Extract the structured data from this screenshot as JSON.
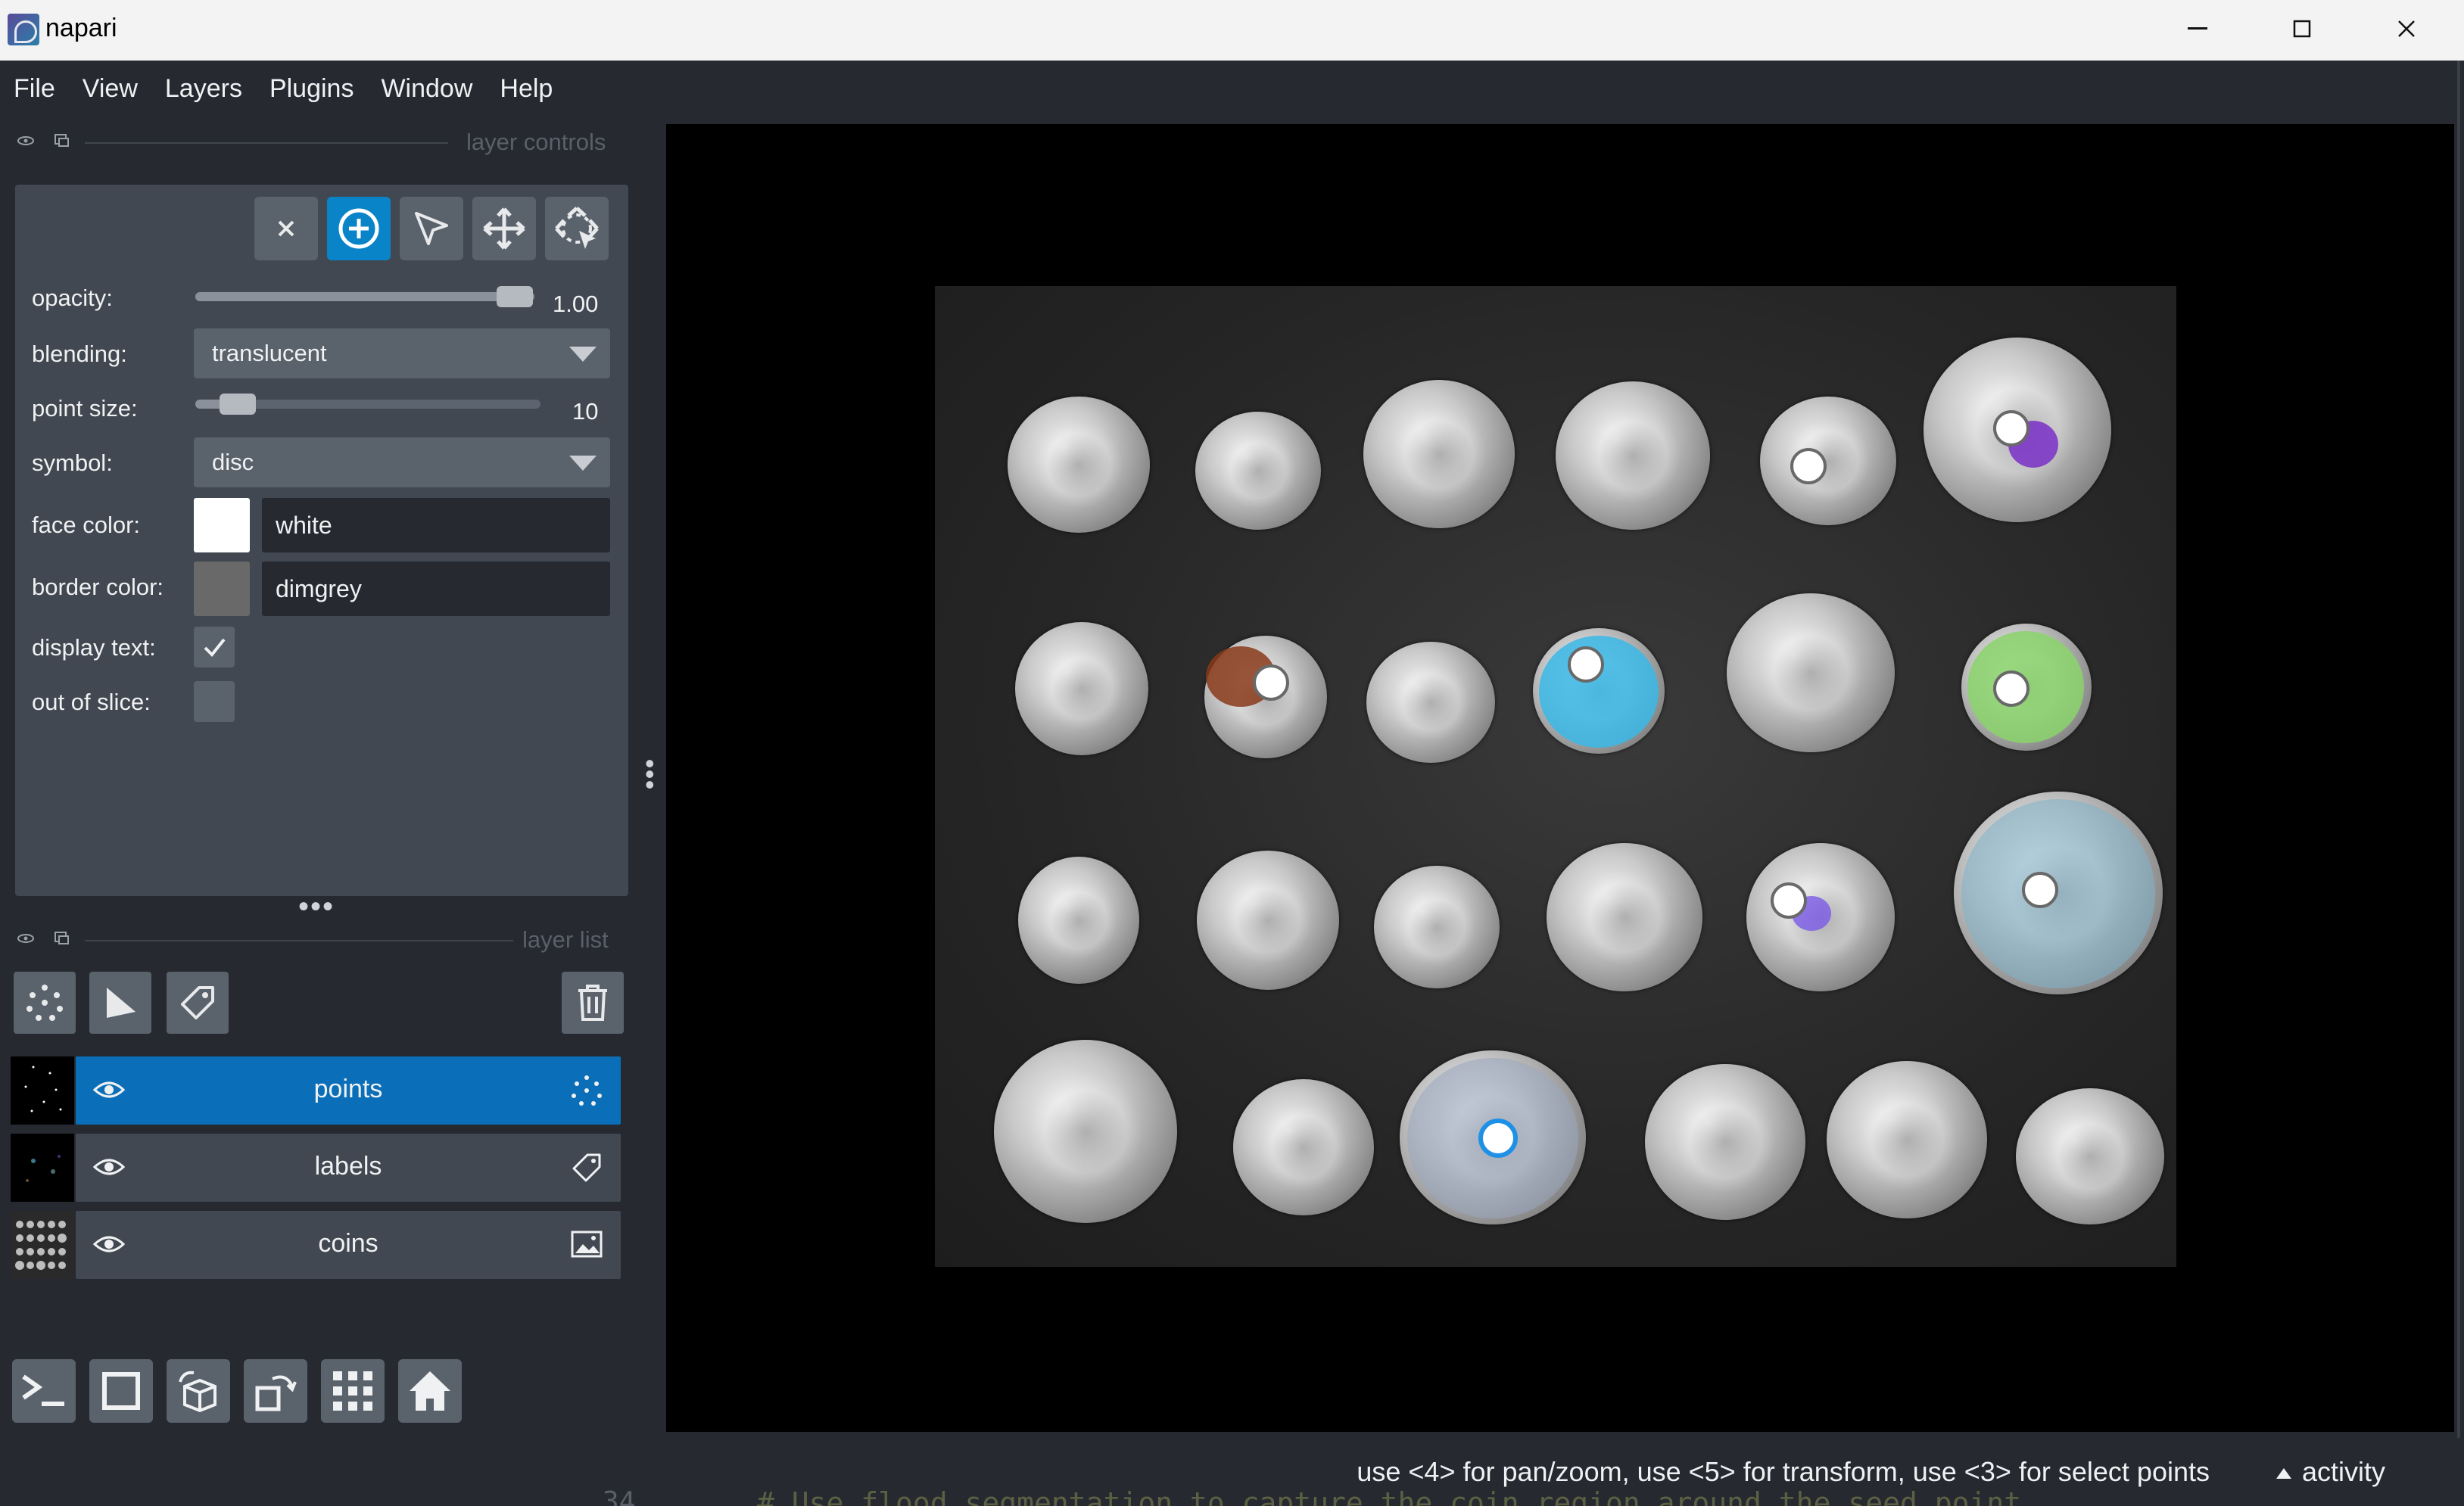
{
  "window": {
    "title": "napari"
  },
  "menu": [
    "File",
    "View",
    "Layers",
    "Plugins",
    "Window",
    "Help"
  ],
  "controls": {
    "header": "layer controls",
    "opacity": {
      "label": "opacity:",
      "value": "1.00",
      "fraction": 1.0
    },
    "blending": {
      "label": "blending:",
      "value": "translucent"
    },
    "point_size": {
      "label": "point size:",
      "value": "10",
      "fraction": 0.12
    },
    "symbol": {
      "label": "symbol:",
      "value": "disc"
    },
    "face_color": {
      "label": "face color:",
      "value": "white",
      "swatch": "#ffffff"
    },
    "border_color": {
      "label": "border color:",
      "value": "dimgrey",
      "swatch": "#696969"
    },
    "display_text": {
      "label": "display text:",
      "checked": true
    },
    "out_of_slice": {
      "label": "out of slice:",
      "checked": false
    }
  },
  "layer_list": {
    "header": "layer list",
    "layers": [
      {
        "name": "points",
        "selected": true,
        "visible": true,
        "type_icon": "points-icon"
      },
      {
        "name": "labels",
        "selected": false,
        "visible": true,
        "type_icon": "tag-icon"
      },
      {
        "name": "coins",
        "selected": false,
        "visible": true,
        "type_icon": "image-icon"
      }
    ]
  },
  "status": {
    "message": "use <4> for pan/zoom, use <5> for transform, use <3> for select points",
    "activity": "activity"
  },
  "background_code": {
    "line_number": "34",
    "text": "# Use flood segmentation to capture the coin region around the seed point"
  },
  "colors": {
    "accent": "#0a84c8",
    "panel": "#414851",
    "background": "#262930"
  }
}
